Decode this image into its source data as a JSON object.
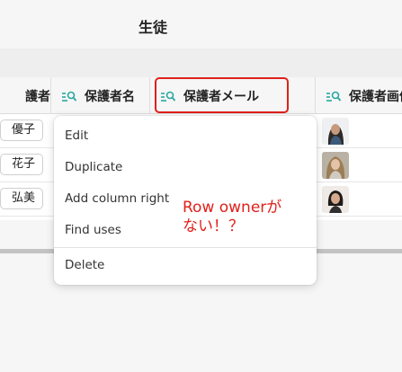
{
  "page": {
    "title": "生徒"
  },
  "columns": [
    {
      "label": "護者",
      "icon": "search-list-icon"
    },
    {
      "label": "保護者名",
      "icon": "search-list-icon"
    },
    {
      "label": "保護者メール",
      "icon": "search-list-icon"
    },
    {
      "label": "保護者画像",
      "icon": "search-list-icon"
    }
  ],
  "rows": [
    {
      "name": "優子",
      "image": "guardian-photo-1"
    },
    {
      "name": "花子",
      "image": "guardian-photo-2"
    },
    {
      "name": "弘美",
      "image": "guardian-photo-3"
    }
  ],
  "context_menu": {
    "items": [
      "Edit",
      "Duplicate",
      "Add column right",
      "Find uses"
    ],
    "delete": "Delete"
  },
  "annotation": {
    "line1": "Row ownerが",
    "line2": "ない！？"
  },
  "colors": {
    "icon": "#2aa7a0",
    "highlight": "#e0201a",
    "annotation": "#e0201a"
  }
}
